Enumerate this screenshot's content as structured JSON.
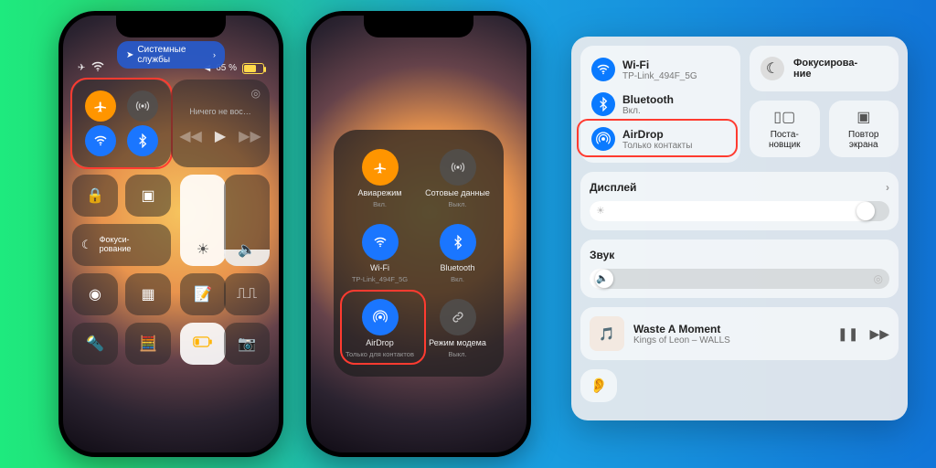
{
  "phone1": {
    "pill": "Системные службы",
    "battery_text": "65 %",
    "music_status": "Ничего не вос…",
    "focus_label": "Фокуси-\nрование"
  },
  "phone2": {
    "cells": [
      {
        "name": "airplane",
        "label": "Авиарежим",
        "sub": "Вкл.",
        "cls": "orange",
        "icon": "airplane"
      },
      {
        "name": "cellular",
        "label": "Сотовые данные",
        "sub": "Выкл.",
        "cls": "grey",
        "icon": "antenna"
      },
      {
        "name": "wifi",
        "label": "Wi-Fi",
        "sub": "TP-Link_494F_5G",
        "cls": "blue",
        "icon": "wifi"
      },
      {
        "name": "bluetooth",
        "label": "Bluetooth",
        "sub": "Вкл.",
        "cls": "blue",
        "icon": "bt"
      },
      {
        "name": "airdrop",
        "label": "AirDrop",
        "sub": "Только для контактов",
        "cls": "blue",
        "icon": "airdrop"
      },
      {
        "name": "hotspot",
        "label": "Режим модема",
        "sub": "Выкл.",
        "cls": "grey",
        "icon": "link"
      }
    ]
  },
  "mac": {
    "conn": [
      {
        "title": "Wi-Fi",
        "sub": "TP-Link_494F_5G",
        "icon": "wifi"
      },
      {
        "title": "Bluetooth",
        "sub": "Вкл.",
        "icon": "bt"
      },
      {
        "title": "AirDrop",
        "sub": "Только контакты",
        "icon": "airdrop"
      }
    ],
    "focus": "Фокусирова-\nние",
    "stage": "Поста-\nновщик",
    "mirror": "Повтор\nэкрана",
    "display": "Дисплей",
    "sound": "Звук",
    "track": "Waste A Moment",
    "artist": "Kings of Leon – WALLS",
    "display_level": 0.95,
    "sound_level": 0.08
  }
}
